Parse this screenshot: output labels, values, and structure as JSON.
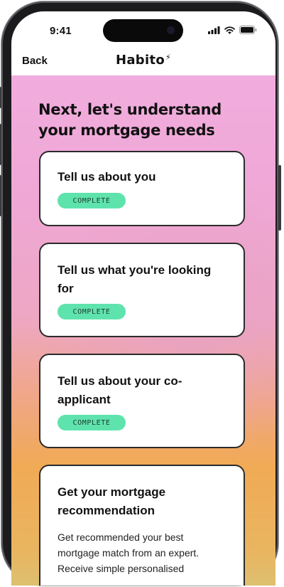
{
  "status_bar": {
    "time": "9:41"
  },
  "nav": {
    "back_label": "Back",
    "logo_text": "Habito",
    "logo_mark": "⚡"
  },
  "page": {
    "heading": "Next, let's understand your mortgage needs"
  },
  "cards": [
    {
      "title": "Tell us about you",
      "status": "COMPLETE"
    },
    {
      "title": "Tell us what you're looking for",
      "status": "COMPLETE"
    },
    {
      "title": "Tell us about your co-applicant",
      "status": "COMPLETE"
    },
    {
      "title": "Get your mortgage recommendation",
      "description": "Get recommended your best mortgage match from an expert. Receive simple personalised"
    }
  ],
  "colors": {
    "badge_bg": "#5fe3ad",
    "card_border": "#2b2b2b",
    "gradient_top": "#f2b0e2",
    "gradient_bottom": "#f1aa55"
  },
  "icons": [
    "signal-icon",
    "wifi-icon",
    "battery-icon"
  ]
}
